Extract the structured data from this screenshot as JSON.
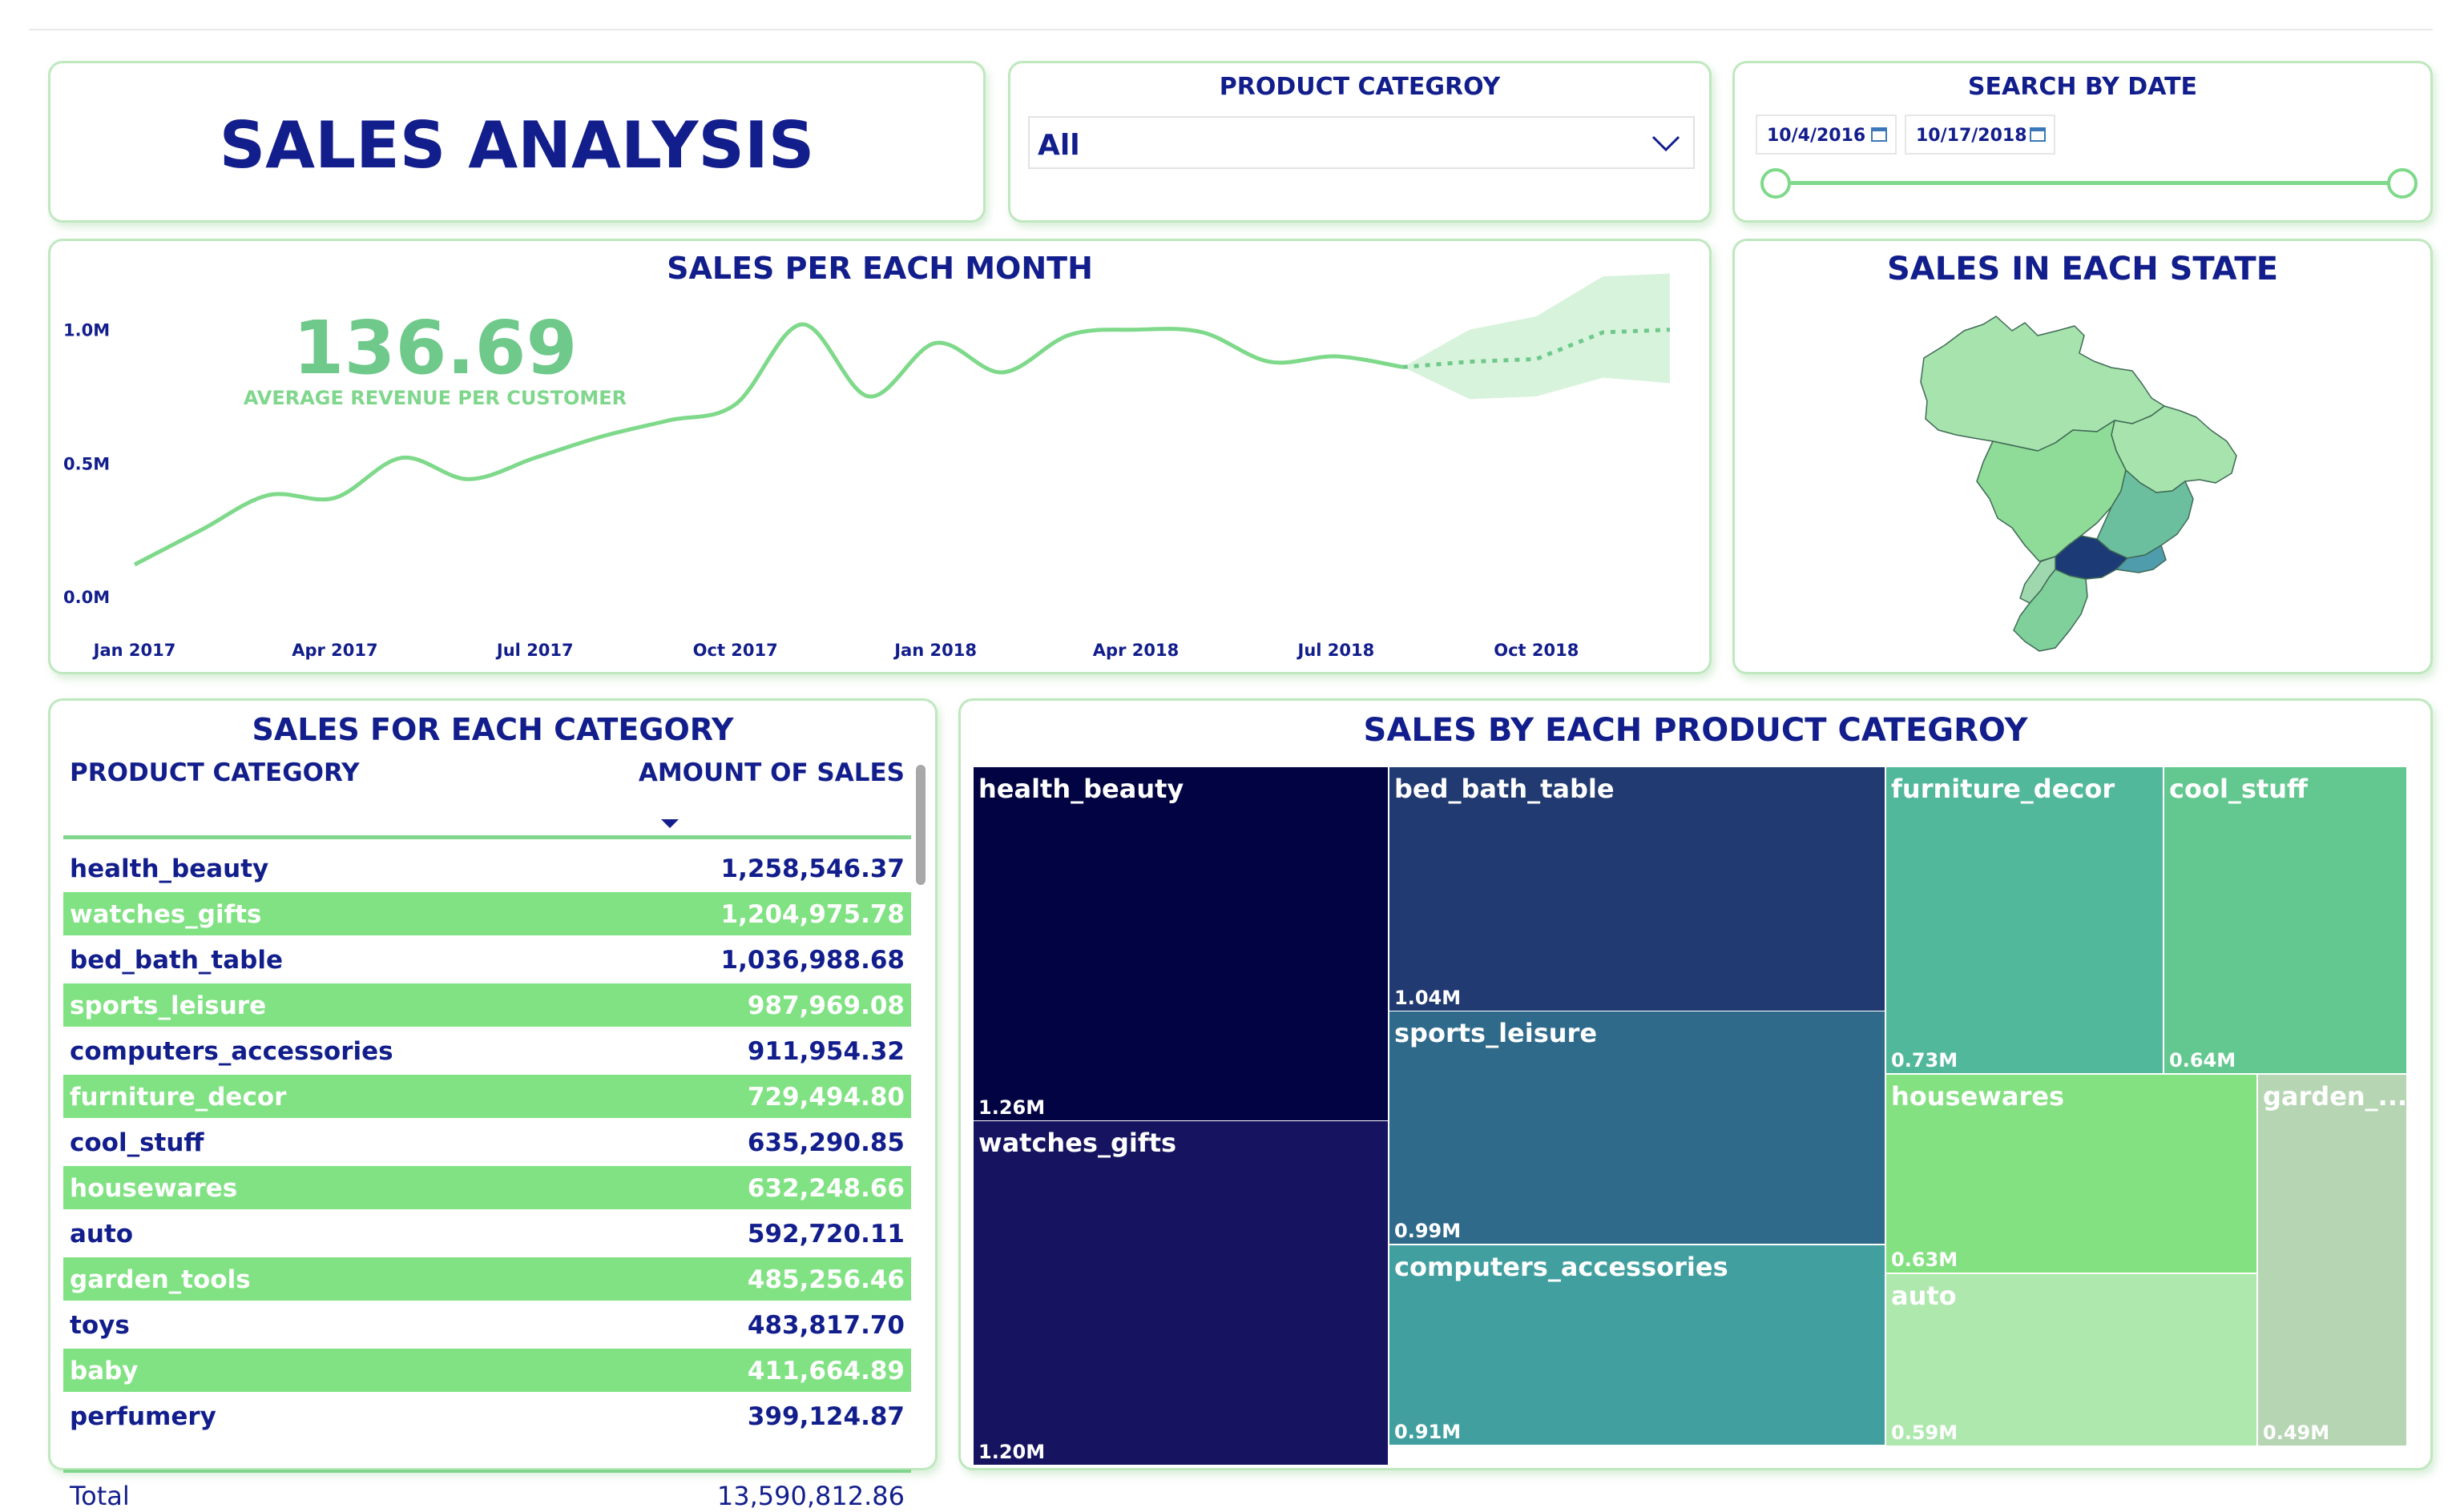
{
  "header": {
    "title": "SALES ANALYSIS",
    "filter_title": "PRODUCT CATEGROY",
    "filter_value": "All",
    "date_title": "SEARCH BY DATE",
    "date_start": "10/4/2016",
    "date_end": "10/17/2018"
  },
  "kpi": {
    "value": "136.69",
    "label": "AVERAGE REVENUE PER CUSTOMER"
  },
  "colors": {
    "navy": "#121e8c",
    "green": "#80e283",
    "line": "#7ed98a"
  },
  "state_map": {
    "title": "SALES IN EACH STATE"
  },
  "table": {
    "title": "SALES FOR EACH CATEGORY",
    "col1": "PRODUCT CATEGORY",
    "col2": "AMOUNT OF SALES",
    "rows": [
      {
        "category": "health_beauty",
        "amount": "1,258,546.37"
      },
      {
        "category": "watches_gifts",
        "amount": "1,204,975.78"
      },
      {
        "category": "bed_bath_table",
        "amount": "1,036,988.68"
      },
      {
        "category": "sports_leisure",
        "amount": "987,969.08"
      },
      {
        "category": "computers_accessories",
        "amount": "911,954.32"
      },
      {
        "category": "furniture_decor",
        "amount": "729,494.80"
      },
      {
        "category": "cool_stuff",
        "amount": "635,290.85"
      },
      {
        "category": "housewares",
        "amount": "632,248.66"
      },
      {
        "category": "auto",
        "amount": "592,720.11"
      },
      {
        "category": "garden_tools",
        "amount": "485,256.46"
      },
      {
        "category": "toys",
        "amount": "483,817.70"
      },
      {
        "category": "baby",
        "amount": "411,664.89"
      },
      {
        "category": "perfumery",
        "amount": "399,124.87"
      }
    ],
    "total_label": "Total",
    "total_value": "13,590,812.86"
  },
  "treemap": {
    "title": "SALES BY EACH PRODUCT CATEGROY",
    "tiles": [
      {
        "name": "health_beauty",
        "label": "1.26M",
        "color": "#020342"
      },
      {
        "name": "watches_gifts",
        "label": "1.20M",
        "color": "#161460"
      },
      {
        "name": "bed_bath_table",
        "label": "1.04M",
        "color": "#213a72"
      },
      {
        "name": "sports_leisure",
        "label": "0.99M",
        "color": "#2f6a8b"
      },
      {
        "name": "computers_accessories",
        "label": "0.91M",
        "color": "#429fa0"
      },
      {
        "name": "furniture_decor",
        "label": "0.73M",
        "color": "#52b89b"
      },
      {
        "name": "cool_stuff",
        "label": "0.64M",
        "color": "#62c88f"
      },
      {
        "name": "housewares",
        "label": "0.63M",
        "color": "#84e181"
      },
      {
        "name": "auto",
        "label": "0.59M",
        "color": "#aee8ad"
      },
      {
        "name": "garden_...",
        "label": "0.49M",
        "color": "#b6d6b3"
      }
    ]
  },
  "chart_data": {
    "type": "line",
    "title": "SALES PER EACH MONTH",
    "x": [
      "Jan 2017",
      "Feb 2017",
      "Mar 2017",
      "Apr 2017",
      "May 2017",
      "Jun 2017",
      "Jul 2017",
      "Aug 2017",
      "Sep 2017",
      "Oct 2017",
      "Nov 2017",
      "Dec 2017",
      "Jan 2018",
      "Feb 2018",
      "Mar 2018",
      "Apr 2018",
      "May 2018",
      "Jun 2018",
      "Jul 2018",
      "Aug 2018"
    ],
    "values": [
      0.12,
      0.25,
      0.38,
      0.37,
      0.52,
      0.44,
      0.52,
      0.6,
      0.66,
      0.72,
      1.02,
      0.75,
      0.95,
      0.84,
      0.98,
      1.0,
      0.99,
      0.88,
      0.9,
      0.86
    ],
    "forecast_x": [
      "Aug 2018",
      "Sep 2018",
      "Oct 2018",
      "Nov 2018",
      "Dec 2018"
    ],
    "forecast": [
      0.86,
      0.88,
      0.89,
      0.99,
      1.0
    ],
    "forecast_upper": [
      0.86,
      1.0,
      1.05,
      1.2,
      1.21
    ],
    "forecast_lower": [
      0.86,
      0.74,
      0.75,
      0.82,
      0.8
    ],
    "x_ticks": [
      "Jan 2017",
      "Apr 2017",
      "Jul 2017",
      "Oct 2017",
      "Jan 2018",
      "Apr 2018",
      "Jul 2018",
      "Oct 2018"
    ],
    "y_ticks": [
      "0.0M",
      "0.5M",
      "1.0M"
    ],
    "ylim": [
      0,
      1.2
    ],
    "xlabel": "",
    "ylabel": ""
  }
}
